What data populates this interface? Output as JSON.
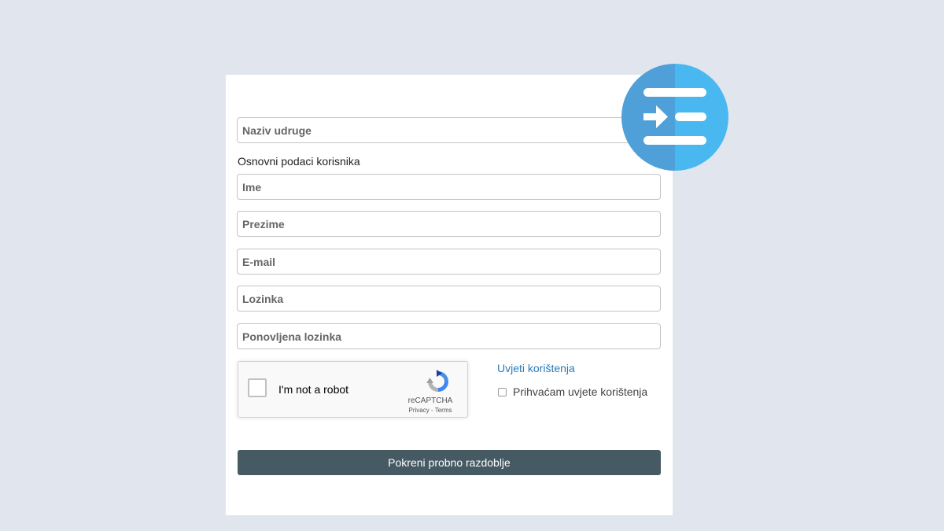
{
  "colors": {
    "page_background": "#e1e6ee",
    "card_background": "#ffffff",
    "logo_left": "#4fa0d8",
    "logo_right": "#4ab8f0",
    "link": "#2a7ab8",
    "button": "#465a63"
  },
  "logo": {
    "icon": "indent-arrow-lines-icon"
  },
  "form": {
    "organization_placeholder": "Naziv udruge",
    "section_label": "Osnovni podaci korisnika",
    "first_name_placeholder": "Ime",
    "last_name_placeholder": "Prezime",
    "email_placeholder": "E-mail",
    "password_placeholder": "Lozinka",
    "password_repeat_placeholder": "Ponovljena lozinka"
  },
  "recaptcha": {
    "label": "I'm not a robot",
    "brand": "reCAPTCHA",
    "privacy": "Privacy",
    "separator": " - ",
    "terms": "Terms"
  },
  "terms": {
    "link_label": "Uvjeti korištenja",
    "accept_label": "Prihvaćam uvjete korištenja"
  },
  "submit_label": "Pokreni probno razdoblje"
}
